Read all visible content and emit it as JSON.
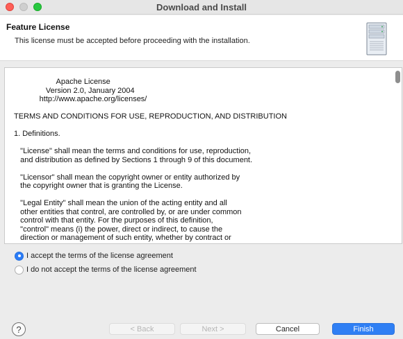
{
  "window": {
    "title": "Download and Install"
  },
  "header": {
    "page_title": "Feature License",
    "description": "This license must be accepted before proceeding with the installation."
  },
  "license": {
    "lines": [
      "                    Apache License",
      "               Version 2.0, January 2004",
      "            http://www.apache.org/licenses/",
      "",
      "TERMS AND CONDITIONS FOR USE, REPRODUCTION, AND DISTRIBUTION",
      "",
      "1. Definitions.",
      "",
      "   \"License\" shall mean the terms and conditions for use, reproduction,",
      "   and distribution as defined by Sections 1 through 9 of this document.",
      "",
      "   \"Licensor\" shall mean the copyright owner or entity authorized by",
      "   the copyright owner that is granting the License.",
      "",
      "   \"Legal Entity\" shall mean the union of the acting entity and all",
      "   other entities that control, are controlled by, or are under common",
      "   control with that entity. For the purposes of this definition,",
      "   \"control\" means (i) the power, direct or indirect, to cause the",
      "   direction or management of such entity, whether by contract or"
    ]
  },
  "options": {
    "accept_label": "I accept the terms of the license agreement",
    "decline_label": "I do not accept the terms of the license agreement",
    "selected": "accept"
  },
  "footer": {
    "help_label": "?",
    "back_label": "< Back",
    "next_label": "Next >",
    "cancel_label": "Cancel",
    "finish_label": "Finish"
  },
  "colors": {
    "accent": "#2f7ff4",
    "close": "#fe5f57",
    "maximize": "#28c840"
  }
}
